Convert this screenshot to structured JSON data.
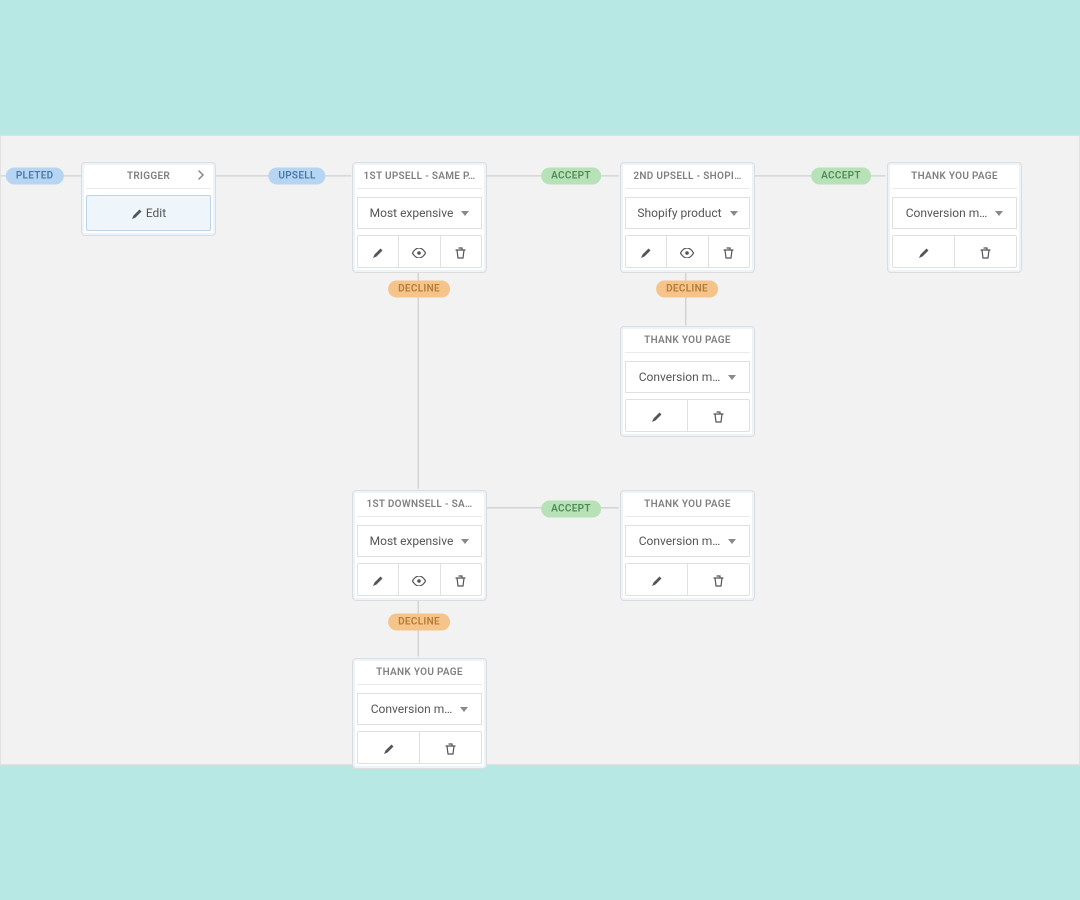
{
  "badges": {
    "completed": "PLETED",
    "upsell": "UPSELL",
    "accept": "ACCEPT",
    "decline": "DECLINE"
  },
  "trigger": {
    "title": "TRIGGER",
    "edit": "Edit"
  },
  "upsell1": {
    "title": "1ST UPSELL - SAME P…",
    "select": "Most expensive"
  },
  "upsell2": {
    "title": "2ND UPSELL - SHOPI…",
    "select": "Shopify product"
  },
  "downsell1": {
    "title": "1ST DOWNSELL - SA…",
    "select": "Most expensive"
  },
  "thankyou": {
    "title": "THANK YOU PAGE",
    "select": "Conversion m…"
  }
}
